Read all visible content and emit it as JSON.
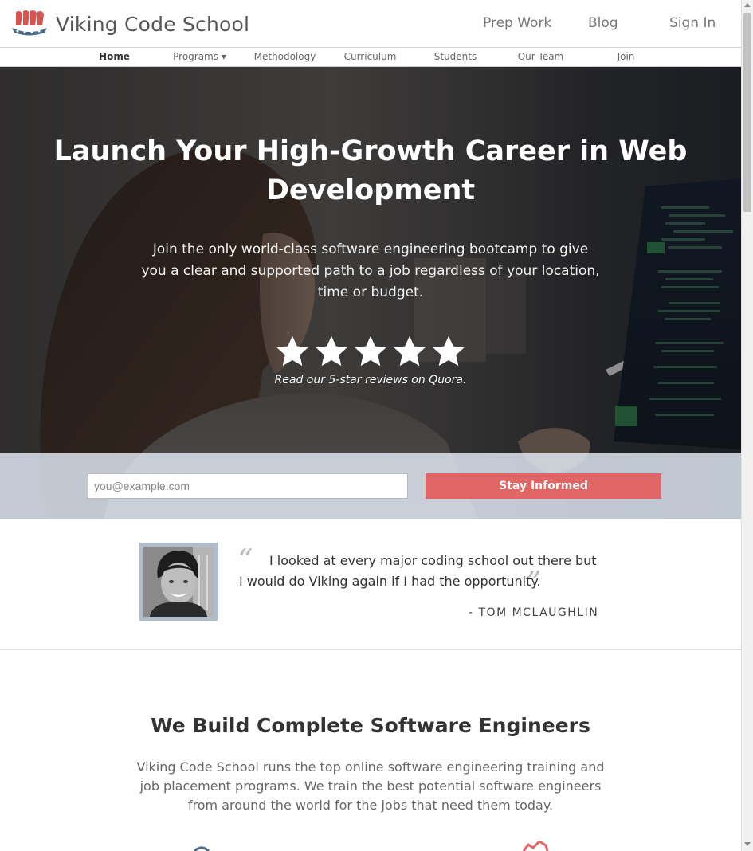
{
  "header": {
    "brand": "Viking Code School",
    "links": [
      {
        "label": "Prep Work"
      },
      {
        "label": "Blog"
      },
      {
        "label": "Sign In"
      }
    ]
  },
  "subnav": {
    "items": [
      {
        "label": "Home",
        "active": true
      },
      {
        "label": "Programs ▾",
        "active": false
      },
      {
        "label": "Methodology",
        "active": false
      },
      {
        "label": "Curriculum",
        "active": false
      },
      {
        "label": "Students",
        "active": false
      },
      {
        "label": "Our Team",
        "active": false
      },
      {
        "label": "Join",
        "active": false
      }
    ]
  },
  "hero": {
    "title": "Launch Your High-Growth Career in Web Development",
    "subtitle": "Join the only world-class software engineering bootcamp to give you a clear and supported path to a job regardless of your location, time or budget.",
    "rating": 5,
    "reviews_link": "Read our 5-star reviews on Quora."
  },
  "signup": {
    "email_placeholder": "you@example.com",
    "button_label": "Stay Informed"
  },
  "testimonial": {
    "quote": "I looked at every major coding school out there but I would do Viking again if I had the opportunity.",
    "author": "- TOM MCLAUGHLIN"
  },
  "section": {
    "title": "We Build Complete Software Engineers",
    "body": "Viking Code School runs the top online software engineering training and job placement programs. We train the best potential software engineers from around the world for the jobs that need them today."
  },
  "colors": {
    "accent": "#e06666",
    "logo_red": "#d9534f",
    "logo_blue": "#4a6b8a"
  },
  "icons": [
    "viking-ship-logo-icon",
    "star-icon",
    "quote-open-icon",
    "quote-close-icon"
  ]
}
